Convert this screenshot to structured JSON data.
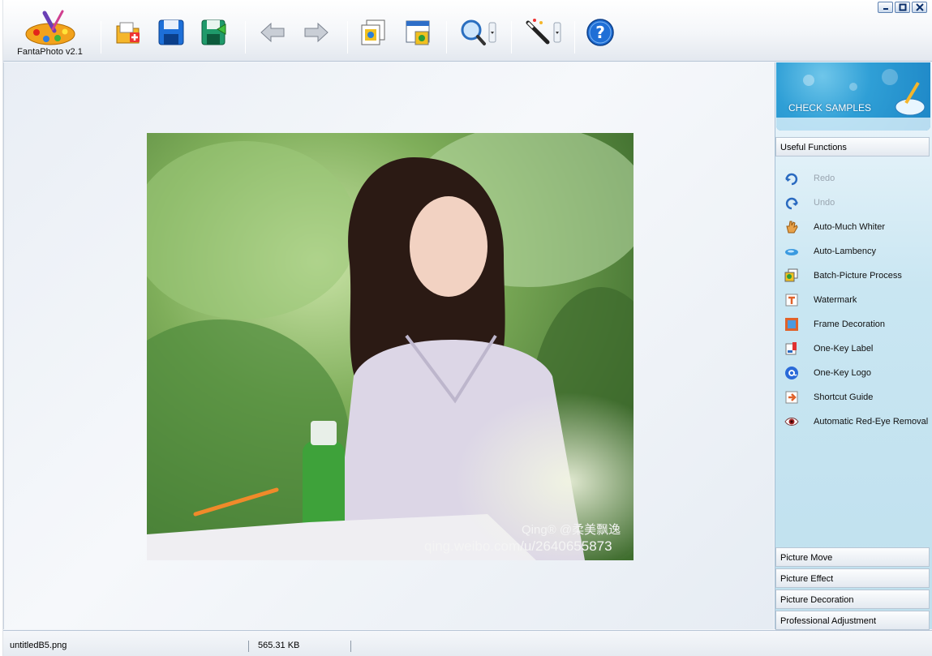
{
  "app": {
    "title": "FantaPhoto v2.1"
  },
  "toolbar": {
    "buttons": [
      "open-icon",
      "save-icon",
      "save-as-icon",
      "undo-arrow-icon",
      "redo-arrow-icon",
      "batch-icon",
      "browser-icon",
      "zoom-icon",
      "magic-wand-icon",
      "help-icon"
    ],
    "help_label": "?"
  },
  "panel": {
    "banner_label": "CHECK SAMPLES",
    "useful_header": "Useful Functions",
    "functions": [
      {
        "label": "Redo",
        "icon": "redo-icon",
        "enabled": false
      },
      {
        "label": "Undo",
        "icon": "undo-icon",
        "enabled": false
      },
      {
        "label": "Auto-Much Whiter",
        "icon": "hand-icon",
        "enabled": true
      },
      {
        "label": "Auto-Lambency",
        "icon": "lambency-icon",
        "enabled": true
      },
      {
        "label": "Batch-Picture Process",
        "icon": "batch-icon",
        "enabled": true
      },
      {
        "label": "Watermark",
        "icon": "watermark-icon",
        "enabled": true
      },
      {
        "label": "Frame Decoration",
        "icon": "frame-icon",
        "enabled": true
      },
      {
        "label": "One-Key Label",
        "icon": "label-icon",
        "enabled": true
      },
      {
        "label": "One-Key Logo",
        "icon": "logo-icon",
        "enabled": true
      },
      {
        "label": "Shortcut Guide",
        "icon": "shortcut-icon",
        "enabled": true
      },
      {
        "label": "Automatic Red-Eye Removal",
        "icon": "eye-icon",
        "enabled": true
      }
    ],
    "sections": [
      "Picture Move",
      "Picture Effect",
      "Picture Decoration",
      "Professional Adjustment"
    ]
  },
  "image": {
    "watermark_top": "Qing® @柔美飘逸",
    "watermark_url": "qing.weibo.com/u/2640655873"
  },
  "status": {
    "filename": "untitledB5.png",
    "filesize": "565.31 KB"
  }
}
